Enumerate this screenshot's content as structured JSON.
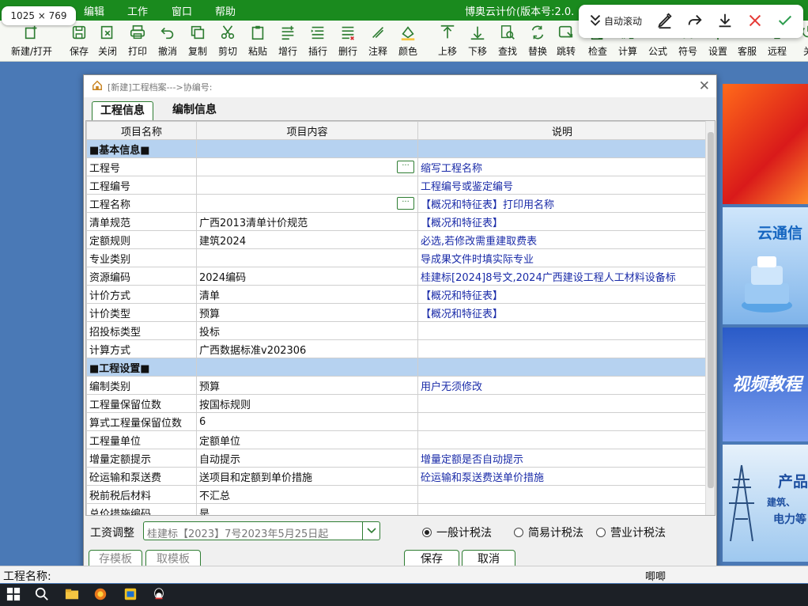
{
  "screen_badge": "1025 × 769",
  "menubar": {
    "items": [
      "编辑",
      "工作",
      "窗口",
      "帮助"
    ],
    "app_title": "博奥云计价(版本号:2.0."
  },
  "floatbar": {
    "auto_scroll": "自动滚动"
  },
  "toolbar": [
    {
      "label": "新建/打开",
      "icon": "new-open-icon"
    },
    {
      "label": "保存",
      "icon": "save-icon"
    },
    {
      "label": "关闭",
      "icon": "close-file-icon"
    },
    {
      "label": "打印",
      "icon": "print-icon"
    },
    {
      "label": "撤消",
      "icon": "undo-icon"
    },
    {
      "label": "复制",
      "icon": "copy-icon"
    },
    {
      "label": "剪切",
      "icon": "cut-icon"
    },
    {
      "label": "粘贴",
      "icon": "paste-icon"
    },
    {
      "label": "增行",
      "icon": "add-row-icon"
    },
    {
      "label": "插行",
      "icon": "insert-row-icon"
    },
    {
      "label": "删行",
      "icon": "delete-row-icon"
    },
    {
      "label": "注释",
      "icon": "comment-icon"
    },
    {
      "label": "颜色",
      "icon": "color-icon"
    },
    {
      "label": "上移",
      "icon": "move-up-icon"
    },
    {
      "label": "下移",
      "icon": "move-down-icon"
    },
    {
      "label": "查找",
      "icon": "find-icon"
    },
    {
      "label": "替换",
      "icon": "replace-icon"
    },
    {
      "label": "跳转",
      "icon": "jump-icon"
    },
    {
      "label": "检查",
      "icon": "check-icon"
    },
    {
      "label": "计算",
      "icon": "calculate-icon"
    },
    {
      "label": "公式",
      "icon": "formula-icon"
    },
    {
      "label": "符号",
      "icon": "symbol-icon"
    },
    {
      "label": "设置",
      "icon": "settings-icon"
    },
    {
      "label": "客服",
      "icon": "support-icon"
    },
    {
      "label": "远程",
      "icon": "remote-icon"
    },
    {
      "label": "关",
      "icon": "exit-icon"
    }
  ],
  "banners": {
    "b2": "云通信",
    "b3": "视频教程",
    "b4_title": "产品",
    "b4_line1": "建筑、",
    "b4_line2": "电力等"
  },
  "dialog": {
    "title": "[新建]工程档案--->协编号:",
    "tabs": [
      "工程信息",
      "编制信息"
    ],
    "columns": [
      "项目名称",
      "项目内容",
      "说明"
    ],
    "rows": [
      {
        "type": "section",
        "name": "■基本信息■",
        "content": "",
        "desc": ""
      },
      {
        "name": "工程号",
        "content": "",
        "desc": "缩写工程名称",
        "ellipsis": true
      },
      {
        "name": "工程编号",
        "content": "",
        "desc": "工程编号或鉴定编号"
      },
      {
        "name": "工程名称",
        "content": "",
        "desc": "【概况和特征表】打印用名称",
        "ellipsis": true
      },
      {
        "name": "清单规范",
        "content": "广西2013清单计价规范",
        "desc": "【概况和特征表】"
      },
      {
        "name": "定额规则",
        "content": "建筑2024",
        "desc": "必选,若修改需重建取费表"
      },
      {
        "name": "专业类别",
        "content": "",
        "desc": "导成果文件时填实际专业"
      },
      {
        "name": "资源编码",
        "content": "2024编码",
        "desc": "桂建标[2024]8号文,2024广西建设工程人工材料设备标"
      },
      {
        "name": "计价方式",
        "content": "清单",
        "desc": "【概况和特征表】"
      },
      {
        "name": "计价类型",
        "content": "预算",
        "desc": "【概况和特征表】"
      },
      {
        "name": "招投标类型",
        "content": "投标",
        "desc": ""
      },
      {
        "name": "计算方式",
        "content": "广西数据标准v202306",
        "desc": ""
      },
      {
        "type": "section",
        "name": "■工程设置■",
        "content": "",
        "desc": ""
      },
      {
        "name": "编制类别",
        "content": "预算",
        "desc": "用户无须修改"
      },
      {
        "name": "工程量保留位数",
        "content": "按国标规则",
        "desc": ""
      },
      {
        "name": "算式工程量保留位数",
        "content": "6",
        "desc": ""
      },
      {
        "name": "工程量单位",
        "content": "定额单位",
        "desc": ""
      },
      {
        "name": "增量定额提示",
        "content": "自动提示",
        "desc": "增量定额是否自动提示"
      },
      {
        "name": "砼运输和泵送费",
        "content": "送项目和定额到单价措施",
        "desc": "砼运输和泵送费送单价措施"
      },
      {
        "name": "税前税后材料",
        "content": "不汇总",
        "desc": ""
      },
      {
        "name": "总价措施编码",
        "content": "是",
        "desc": ""
      }
    ],
    "ellipsis_label": "···",
    "wage": {
      "label": "工资调整",
      "value": "桂建标【2023】7号2023年5月25日起"
    },
    "tax_options": [
      {
        "label": "一般计税法",
        "selected": true
      },
      {
        "label": "简易计税法",
        "selected": false
      },
      {
        "label": "营业计税法",
        "selected": false
      }
    ],
    "buttons": {
      "save_template": "存模板",
      "load_template": "取模板",
      "save": "保存",
      "cancel": "取消"
    }
  },
  "statusbar": {
    "project_name_label": "工程名称:",
    "right_text": "唧唧"
  },
  "colors": {
    "accent": "#2e7d32",
    "menubar": "#1a8a1e",
    "section_row": "#b6d2f0",
    "desc_text": "#1a2ba8"
  }
}
